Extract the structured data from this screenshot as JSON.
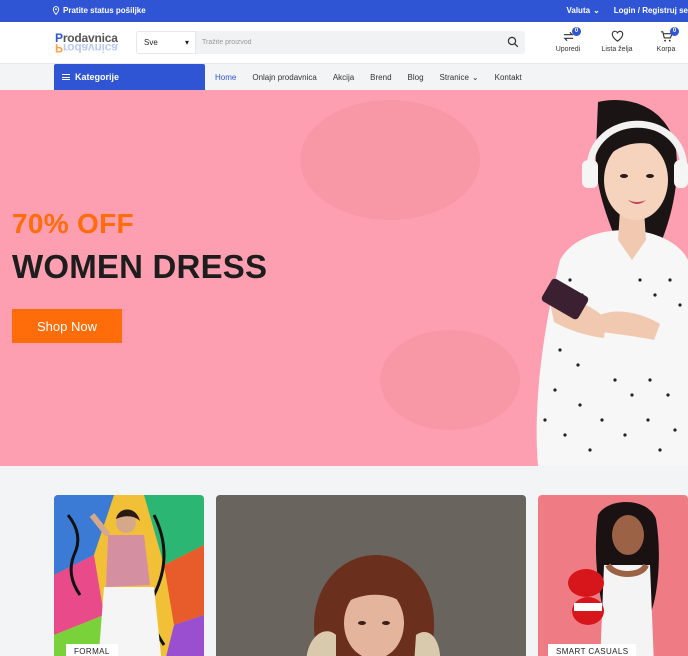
{
  "topbar": {
    "track_label": "Pratite status pošiljke",
    "currency_label": "Valuta",
    "account_label": "Login / Registruj se"
  },
  "header": {
    "logo_text": "Prodavnica",
    "category_select_value": "Sve",
    "search_placeholder": "Tražite proizvod",
    "compare": {
      "label": "Uporedi",
      "count": "0"
    },
    "wishlist": {
      "label": "Lista želja"
    },
    "cart": {
      "label": "Korpa",
      "count": "0"
    }
  },
  "nav": {
    "categories_label": "Kategorije",
    "items": [
      {
        "label": "Home",
        "active": true
      },
      {
        "label": "Onlajn prodavnica"
      },
      {
        "label": "Akcija"
      },
      {
        "label": "Brend"
      },
      {
        "label": "Blog"
      },
      {
        "label": "Stranice",
        "has_dropdown": true
      },
      {
        "label": "Kontakt"
      }
    ]
  },
  "hero": {
    "discount": "70% OFF",
    "title": "WOMEN DRESS",
    "cta_label": "Shop Now",
    "background_color": "#fd9fb0",
    "accent_color": "#ff6d0a"
  },
  "banners": [
    {
      "tag": "FORMAL"
    },
    {
      "tag": ""
    },
    {
      "tag": "SMART CASUALS"
    }
  ],
  "colors": {
    "brand_blue": "#2f55d4",
    "orange": "#ff6d0a"
  }
}
